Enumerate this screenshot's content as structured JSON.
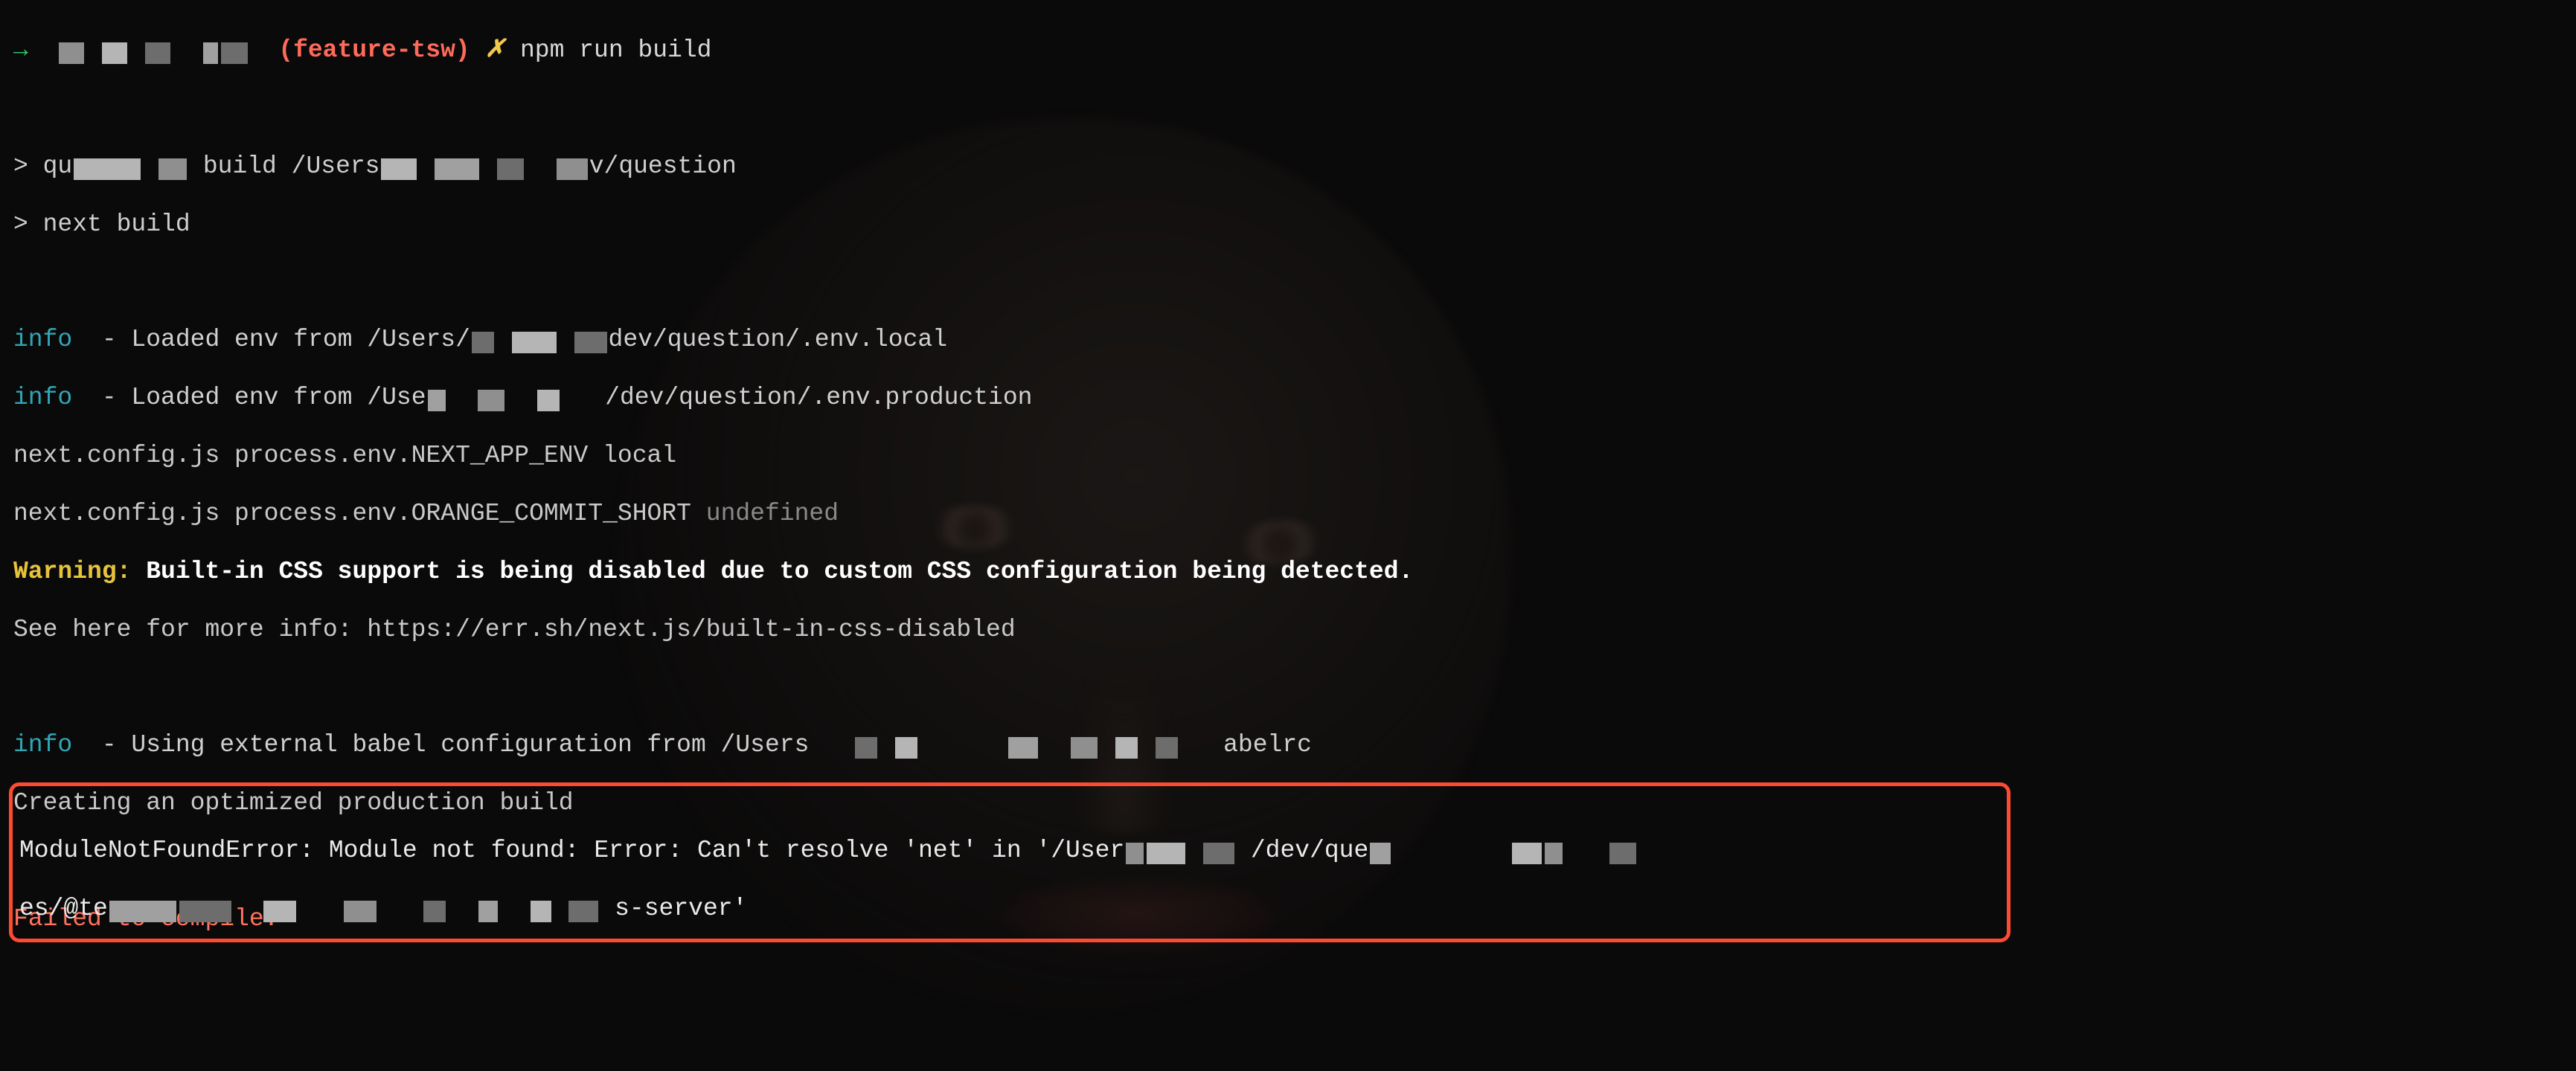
{
  "prompt": {
    "arrow": "→",
    "branch": "(feature-tsw)",
    "symbol": "✗",
    "command": "npm run build"
  },
  "exec": {
    "line1_prefix": "> qu",
    "line1_mid": " build /Users",
    "line1_tail": "v/question",
    "line2": "> next build"
  },
  "info1": {
    "tag": "info",
    "text": "  - Loaded env from /Users/",
    "tail": "dev/question/.env.local"
  },
  "info2": {
    "tag": "info",
    "text": "  - Loaded env from /Use",
    "tail": "/dev/question/.env.production"
  },
  "cfg1": "next.config.js process.env.NEXT_APP_ENV local",
  "cfg2_a": "next.config.js process.env.ORANGE_COMMIT_SHORT ",
  "cfg2_b": "undefined",
  "warning": {
    "label": "Warning:",
    "text": " Built-in CSS support is being disabled due to custom CSS configuration being detected."
  },
  "see": "See here for more info: https://err.sh/next.js/built-in-css-disabled",
  "info3": {
    "tag": "info",
    "text": "  - Using external babel configuration from /Users",
    "tail": "abelrc"
  },
  "creating": "Creating an optimized production build",
  "fail": "Failed to compile.",
  "error": {
    "l1a": "ModuleNotFoundError: Module not found: Error: Can't resolve 'net' in '/User",
    "l1b": " /dev/que",
    "l2a": "es/@te",
    "l2b": "s-server'"
  }
}
